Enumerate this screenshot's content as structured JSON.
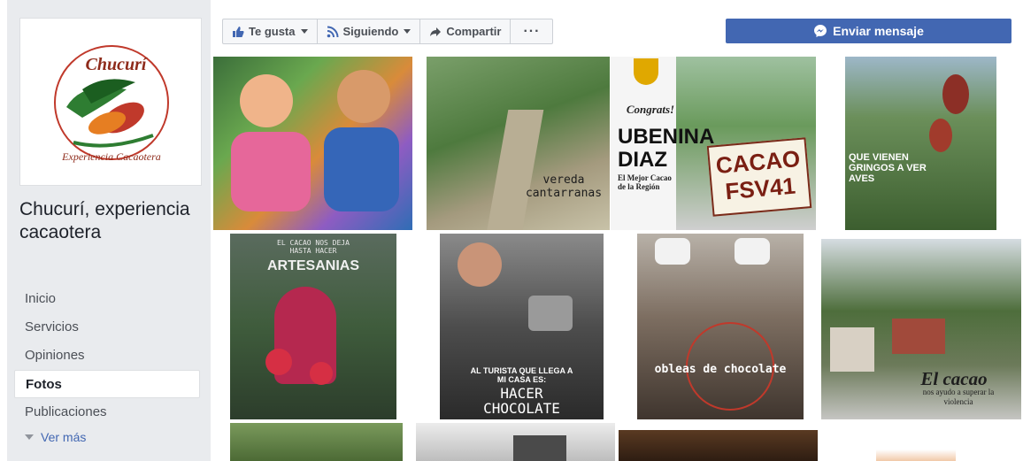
{
  "page": {
    "name": "Chucurí, experiencia cacaotera"
  },
  "logo": {
    "word1": "Chucurí",
    "word2": "Experiencia Cacaotera"
  },
  "nav": {
    "items": [
      {
        "label": "Inicio",
        "active": false
      },
      {
        "label": "Servicios",
        "active": false
      },
      {
        "label": "Opiniones",
        "active": false
      },
      {
        "label": "Fotos",
        "active": true
      },
      {
        "label": "Publicaciones",
        "active": false
      }
    ],
    "see_more": "Ver más"
  },
  "actions": {
    "like": "Te gusta",
    "follow": "Siguiendo",
    "share": "Compartir",
    "more": "···",
    "message": "Enviar mensaje"
  },
  "colors": {
    "brand_blue": "#4267b2",
    "sidebar_bg": "#e9ebee"
  },
  "photos": {
    "p2_line1": "vereda",
    "p2_line2": "cantarranas",
    "p3_congrats": "Congrats!",
    "p3_name1": "UBENINA",
    "p3_name2": "DIAZ",
    "p3_sub1": "El Mejor Cacao",
    "p3_sub2": "de la Región",
    "p3_sign1": "CACAO",
    "p3_sign2": "FSV41",
    "p4_line1": "QUE VIENEN",
    "p4_line2": "GRINGOS A VER",
    "p4_line3": "AVES",
    "p5_small1": "EL CACAO NOS DEJA",
    "p5_small2": "HASTA HACER",
    "p5_big": "ARTESANIAS",
    "p6_small1": "AL TURISTA QUE LLEGA A",
    "p6_small2": "MI CASA ES:",
    "p6_big1": "HACER",
    "p6_big2": "CHOCOLATE",
    "p7_caption": "obleas de chocolate",
    "p8_title": "El cacao",
    "p8_sub1": "nos ayudo a superar la",
    "p8_sub2": "violencia"
  }
}
